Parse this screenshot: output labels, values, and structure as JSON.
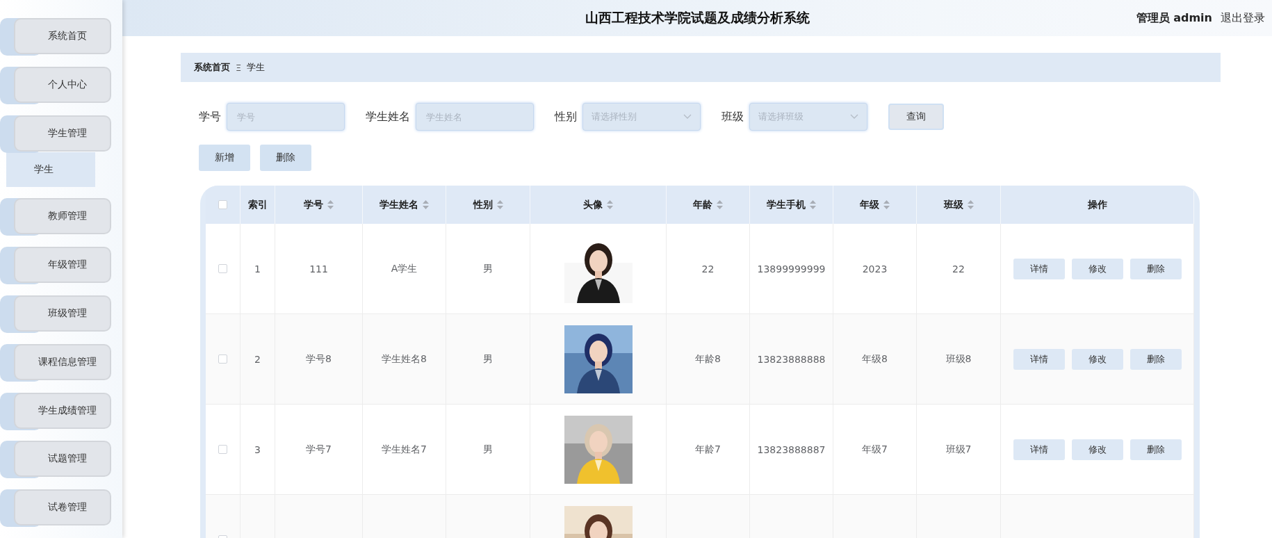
{
  "header": {
    "title": "山西工程技术学院试题及成绩分析系统",
    "user": "管理员 admin",
    "logout": "退出登录"
  },
  "sidebar": {
    "items": [
      {
        "label": "系统首页"
      },
      {
        "label": "个人中心"
      },
      {
        "label": "学生管理",
        "children": [
          {
            "label": "学生"
          }
        ]
      },
      {
        "label": "教师管理"
      },
      {
        "label": "年级管理"
      },
      {
        "label": "班级管理"
      },
      {
        "label": "课程信息管理"
      },
      {
        "label": "学生成绩管理"
      },
      {
        "label": "试题管理"
      },
      {
        "label": "试卷管理"
      }
    ]
  },
  "breadcrumb": {
    "items": [
      "系统首页",
      "学生"
    ],
    "separator": "Ξ"
  },
  "filters": [
    {
      "kind": "input",
      "label": "学号",
      "placeholder": "学号"
    },
    {
      "kind": "input",
      "label": "学生姓名",
      "placeholder": "学生姓名"
    },
    {
      "kind": "select",
      "label": "性别",
      "placeholder": "请选择性别"
    },
    {
      "kind": "select",
      "label": "班级",
      "placeholder": "请选择班级"
    }
  ],
  "query_button": "查询",
  "actions": [
    "新增",
    "删除"
  ],
  "table": {
    "columns": [
      {
        "kind": "checkbox",
        "checked": false
      },
      {
        "kind": "text",
        "label": "索引",
        "sortable": false
      },
      {
        "kind": "text",
        "label": "学号",
        "sortable": true
      },
      {
        "kind": "text",
        "label": "学生姓名",
        "sortable": true
      },
      {
        "kind": "text",
        "label": "性别",
        "sortable": true
      },
      {
        "kind": "picture",
        "label": "头像",
        "sortable": true
      },
      {
        "kind": "text",
        "label": "年龄",
        "sortable": true
      },
      {
        "kind": "text",
        "label": "学生手机",
        "sortable": true
      },
      {
        "kind": "text",
        "label": "年级",
        "sortable": true
      },
      {
        "kind": "text",
        "label": "班级",
        "sortable": true
      },
      {
        "kind": "actions",
        "label": "操作",
        "sortable": false
      }
    ],
    "rows": [
      {
        "cells": [
          {
            "checked": false
          },
          "1",
          "111",
          "A学生",
          "男",
          {
            "kind": "picture"
          },
          "22",
          "13899999999",
          "2023",
          "22",
          {
            "buttons": [
              "详情",
              "修改",
              "删除"
            ]
          }
        ]
      },
      {
        "cells": [
          {
            "checked": false
          },
          "2",
          "学号8",
          "学生姓名8",
          "男",
          {
            "kind": "picture"
          },
          "年龄8",
          "13823888888",
          "年级8",
          "班级8",
          {
            "buttons": [
              "详情",
              "修改",
              "删除"
            ]
          }
        ]
      },
      {
        "cells": [
          {
            "checked": false
          },
          "3",
          "学号7",
          "学生姓名7",
          "男",
          {
            "kind": "picture"
          },
          "年龄7",
          "13823888887",
          "年级7",
          "班级7",
          {
            "buttons": [
              "详情",
              "修改",
              "删除"
            ]
          }
        ]
      },
      {
        "cells": [
          {
            "checked": false
          },
          "",
          "",
          "",
          "",
          {
            "kind": "picture"
          }
        ]
      }
    ]
  }
}
